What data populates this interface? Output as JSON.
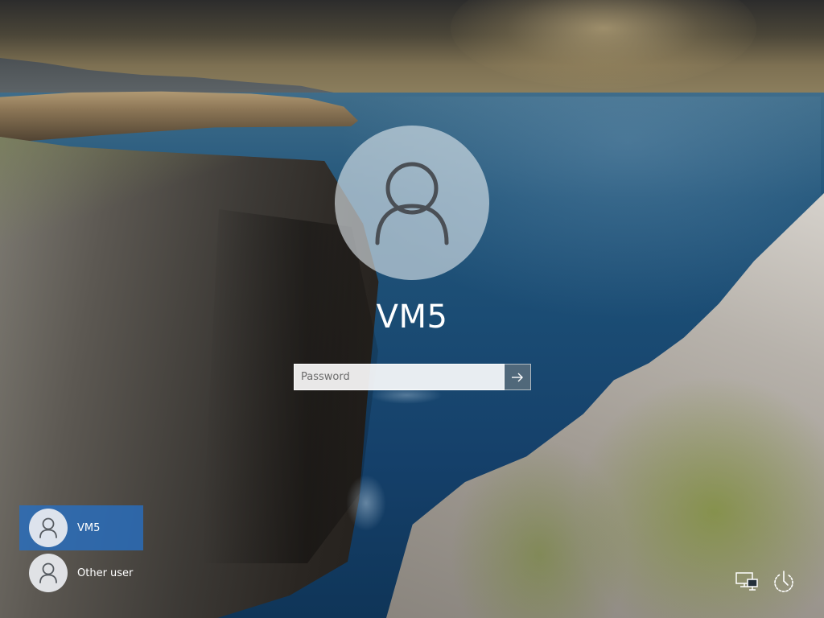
{
  "login": {
    "username": "VM5",
    "password_placeholder": "Password"
  },
  "users": [
    {
      "label": "VM5",
      "selected": true
    },
    {
      "label": "Other user",
      "selected": false
    }
  ],
  "icons": {
    "avatar": "user-silhouette-icon",
    "submit": "arrow-right-icon",
    "network": "network-icon",
    "power": "power-icon"
  },
  "colors": {
    "selected_tile": "#286ebe",
    "submit_button": "#5a6e7d"
  }
}
